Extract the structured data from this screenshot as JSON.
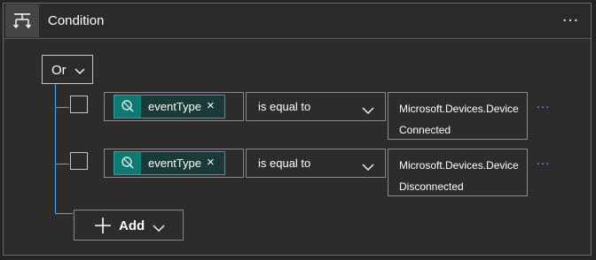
{
  "header": {
    "title": "Condition",
    "icon": "condition-icon",
    "more_label": "…"
  },
  "group": {
    "operator": "Or"
  },
  "rows": [
    {
      "token_label": "eventType",
      "token_icon": "event-grid-icon",
      "remove_label": "×",
      "operator": "is equal to",
      "value": "Microsoft.Devices.DeviceConnected",
      "more_label": "…"
    },
    {
      "token_label": "eventType",
      "token_icon": "event-grid-icon",
      "remove_label": "×",
      "operator": "is equal to",
      "value": "Microsoft.Devices.DeviceDisconnected",
      "more_label": "…"
    }
  ],
  "add_button": {
    "label": "Add"
  },
  "colors": {
    "accent": "#4da6ff",
    "token_bg": "#0e7a75",
    "background": "#2d2c2b"
  }
}
